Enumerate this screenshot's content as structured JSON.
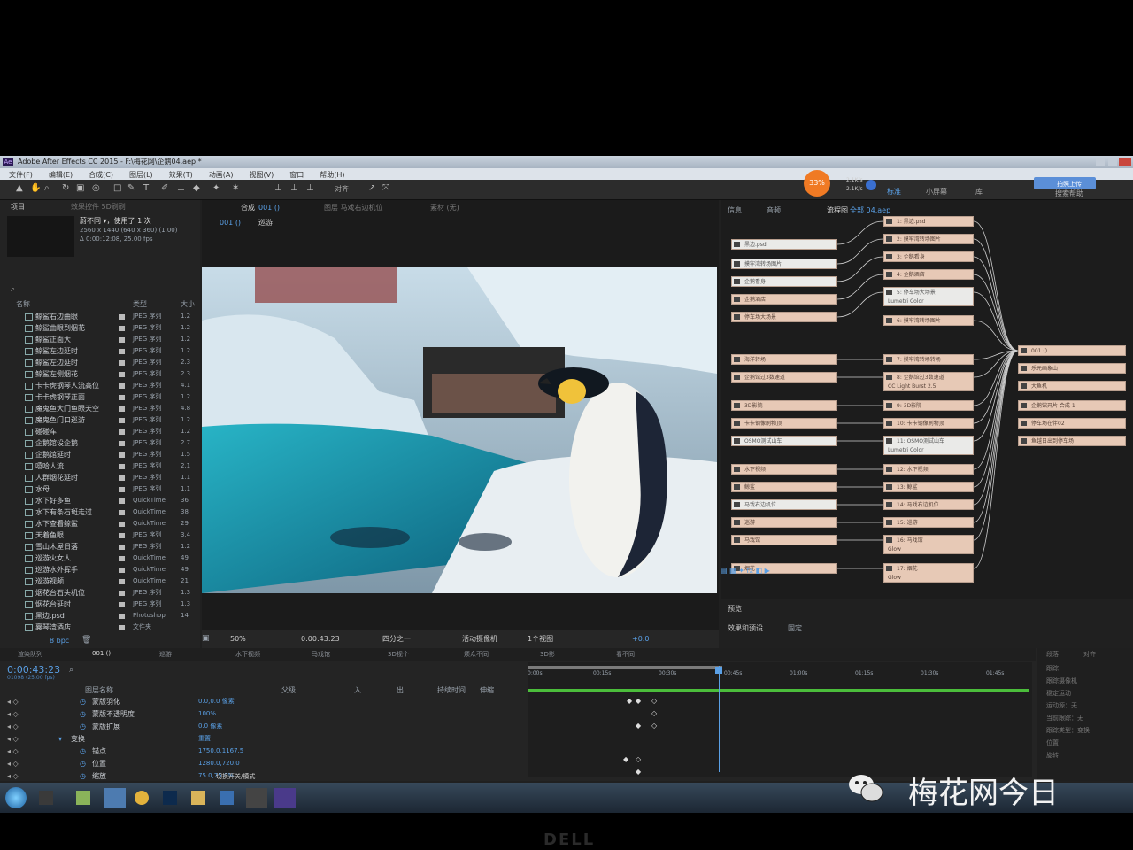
{
  "window": {
    "title": "Adobe After Effects CC 2015 - F:\\梅花网\\企鹅04.aep *",
    "app_badge": "Ae"
  },
  "menu": [
    "文件(F)",
    "编辑(E)",
    "合成(C)",
    "图层(L)",
    "效果(T)",
    "动画(A)",
    "视图(V)",
    "窗口",
    "帮助(H)"
  ],
  "toolbar": {
    "align_label": "对齐",
    "speed_pct": "33%",
    "speed_up": "2.1K/s",
    "speed_down": "2.1K/s",
    "workspace": [
      "标准",
      "小屏幕",
      "库"
    ],
    "search_help": "搜索帮助",
    "upload_label": "拍照上传"
  },
  "project": {
    "title": "项目",
    "effects_tab": "效果控件 5D刷刷",
    "selected_name": "蔚不同 ▾，使用了 1 次",
    "selected_info1": "2560 x 1440 (640 x 360) (1.00)",
    "selected_info2": "Δ 0:00:12:08, 25.00 fps",
    "col_name": "名称",
    "col_type": "类型",
    "col_size": "大小",
    "items": [
      {
        "name": "鲸鲨右边曲眼",
        "type": "JPEG 序列",
        "size": "1.2"
      },
      {
        "name": "鲸鲨曲眼到烟花",
        "type": "JPEG 序列",
        "size": "1.2"
      },
      {
        "name": "鲸鲨正面大",
        "type": "JPEG 序列",
        "size": "1.2"
      },
      {
        "name": "鲸鲨左边延时",
        "type": "JPEG 序列",
        "size": "1.2"
      },
      {
        "name": "鲸鲨左边延时",
        "type": "JPEG 序列",
        "size": "2.3"
      },
      {
        "name": "鲸鲨左侧烟花",
        "type": "JPEG 序列",
        "size": "2.3"
      },
      {
        "name": "卡卡虎钢琴人流高位",
        "type": "JPEG 序列",
        "size": "4.1"
      },
      {
        "name": "卡卡虎钢琴正面",
        "type": "JPEG 序列",
        "size": "1.2"
      },
      {
        "name": "魔鬼鱼大门鱼眼天空",
        "type": "JPEG 序列",
        "size": "4.8"
      },
      {
        "name": "魔鬼鱼门口巡游",
        "type": "JPEG 序列",
        "size": "1.2"
      },
      {
        "name": "碰碰车",
        "type": "JPEG 序列",
        "size": "1.2"
      },
      {
        "name": "企鹅馆设企鹅",
        "type": "JPEG 序列",
        "size": "2.7"
      },
      {
        "name": "企鹅馆延时",
        "type": "JPEG 序列",
        "size": "1.5"
      },
      {
        "name": "嘻哈人流",
        "type": "JPEG 序列",
        "size": "2.1"
      },
      {
        "name": "人群烟花延时",
        "type": "JPEG 序列",
        "size": "1.1"
      },
      {
        "name": "水母",
        "type": "JPEG 序列",
        "size": "1.1"
      },
      {
        "name": "水下好多鱼",
        "type": "QuickTime",
        "size": "36"
      },
      {
        "name": "水下有条石斑走过",
        "type": "QuickTime",
        "size": "38"
      },
      {
        "name": "水下查看鲸鲨",
        "type": "QuickTime",
        "size": "29"
      },
      {
        "name": "天着鱼眼",
        "type": "JPEG 序列",
        "size": "3.4"
      },
      {
        "name": "雪山木屋日落",
        "type": "JPEG 序列",
        "size": "1.2"
      },
      {
        "name": "巡游火女人",
        "type": "QuickTime",
        "size": "49"
      },
      {
        "name": "巡游水外挥手",
        "type": "QuickTime",
        "size": "49"
      },
      {
        "name": "巡游视频",
        "type": "QuickTime",
        "size": "21"
      },
      {
        "name": "烟花台石头机位",
        "type": "JPEG 序列",
        "size": "1.3"
      },
      {
        "name": "烟花台延时",
        "type": "JPEG 序列",
        "size": "1.3"
      },
      {
        "name": "黑边.psd",
        "type": "Photoshop",
        "size": "14"
      },
      {
        "name": "襄琴湾酒店",
        "type": "文件夹",
        "size": ""
      }
    ],
    "footer": "8 bpc"
  },
  "viewer": {
    "comp_label": "合成",
    "comp_name": "001 ()",
    "layer_label": "图层 马戏右边机位",
    "footage_label": "素材 (无)",
    "breadcrumb1": "001 ()",
    "breadcrumb2": "巡游",
    "zoom": "50%",
    "timecode": "0:00:43:23",
    "resolution": "四分之一",
    "camera": "活动摄像机",
    "views": "1个视图",
    "exposure": "+0.0"
  },
  "flow": {
    "tabs": [
      "信息",
      "音频",
      "流程图"
    ],
    "flow_comp": "全部 04.aep",
    "left_nodes": [
      "黑边.psd",
      "摸牢湾转场图片",
      "企鹅看身",
      "企鹅酒店",
      "停车场大场景",
      "海洋转场",
      "企鹅馆过3数速道",
      "3D影院",
      "卡卡钢像刷物顶",
      "OSMO测试山车",
      "水下视频",
      "鲸鲨",
      "马戏右边机位",
      "巡游",
      "马戏馆",
      "烟花"
    ],
    "mid_nodes": [
      "1: 黑边.psd",
      "2: 摸牢湾转场图片",
      "3: 企鹅看身",
      "4: 企鹅酒店",
      "5: 停车场大场景",
      "6: 摸牢湾转场图片",
      "7: 摸牢湾转场转场",
      "8: 企鹅馆过3数速道",
      "9: 3D影院",
      "10: 卡卡钢像刷物顶",
      "11: OSMO测试山车",
      "12: 水下视频",
      "13: 鲸鲨",
      "14: 马戏右边机位",
      "15: 巡游",
      "16: 马戏馆",
      "17: 烟花"
    ],
    "mid_sub": {
      "5": "Lumetri Color",
      "8": "CC Light Burst 2.5",
      "11": "Lumetri Color",
      "16": "Glow",
      "17": "Glow"
    },
    "right_nodes": [
      "001 ()",
      "乐元画象山",
      "大鱼机",
      "企鹅馆开片 合成 1",
      "停车场在伴02",
      "鱼越日出到停车场"
    ],
    "preview": "预览",
    "effects_presets": "效果和预设",
    "fixed": "固定"
  },
  "timeline": {
    "tabs": [
      "渲染队列",
      "001 ()",
      "巡游",
      "水下视频",
      "马戏馆",
      "3D视个",
      "烦众不同",
      "3D影",
      "看不同"
    ],
    "timecode": "0:00:43:23",
    "frames": "01098 (25.00 fps)",
    "col_layer": "图层名称",
    "col_parent": "父级",
    "col_in": "入",
    "col_out": "出",
    "col_dur": "持续时间",
    "col_stretch": "伸缩",
    "ruler": [
      "0:00s",
      "00:15s",
      "00:30s",
      "00:45s",
      "01:00s",
      "01:15s",
      "01:30s",
      "01:45s"
    ],
    "props": [
      {
        "name": "蒙版羽化",
        "value": "0.0,0.0 像素"
      },
      {
        "name": "蒙版不透明度",
        "value": "100%"
      },
      {
        "name": "蒙版扩展",
        "value": "0.0 像素"
      },
      {
        "name": "变换",
        "value": "重置"
      },
      {
        "name": "锚点",
        "value": "1750.0,1167.5"
      },
      {
        "name": "位置",
        "value": "1280.0,720.0"
      },
      {
        "name": "缩放",
        "value": "75.0,75.0%"
      }
    ],
    "toggle": "切换开关/模式",
    "right_panel": [
      "段落",
      "对齐",
      "跟踪",
      "跟踪摄像机",
      "稳定运动",
      "运动源：无",
      "当前跟踪：无",
      "跟踪类型：变换",
      "位置",
      "旋转"
    ]
  },
  "watermark": {
    "text": "梅花网今日"
  },
  "monitor_logo": "DELL"
}
